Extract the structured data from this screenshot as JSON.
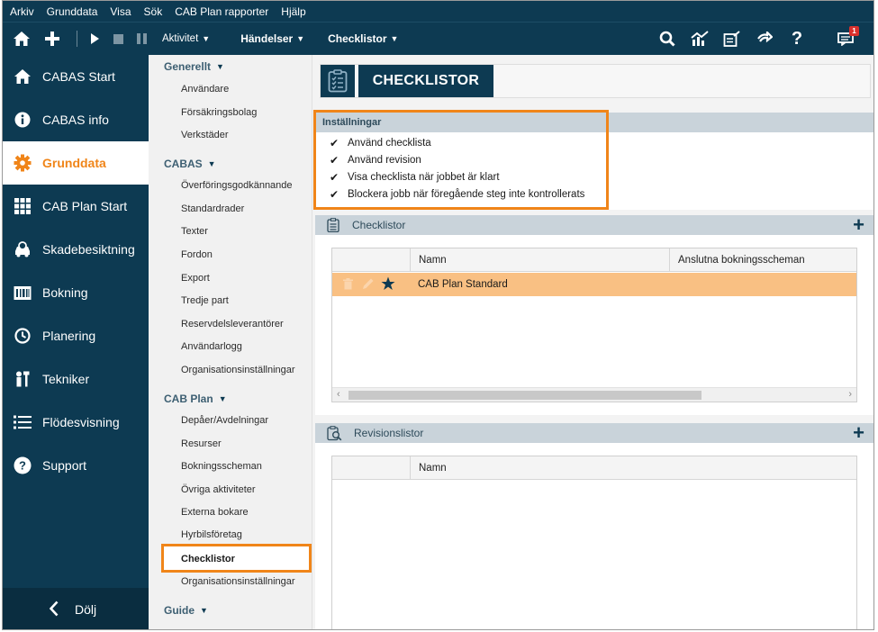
{
  "menubar": [
    "Arkiv",
    "Grunddata",
    "Visa",
    "Sök",
    "CAB Plan rapporter",
    "Hjälp"
  ],
  "toolbar": {
    "activity_label": "Aktivitet",
    "events_label": "Händelser",
    "checklists_label": "Checklistor",
    "notification_count": "1",
    "icons": [
      "home-icon",
      "add-icon",
      "play-icon",
      "stop-icon",
      "pause-icon",
      "search-icon",
      "chart-icon",
      "report-icon",
      "redo-icon",
      "help-icon",
      "notification-icon"
    ]
  },
  "leftnav": {
    "items": [
      {
        "label": "CABAS Start",
        "icon": "home-icon"
      },
      {
        "label": "CABAS info",
        "icon": "info-icon"
      },
      {
        "label": "Grunddata",
        "icon": "gear-icon",
        "active": true
      },
      {
        "label": "CAB Plan Start",
        "icon": "grid-icon"
      },
      {
        "label": "Skadebesiktning",
        "icon": "car-inspection-icon"
      },
      {
        "label": "Bokning",
        "icon": "calendar-icon"
      },
      {
        "label": "Planering",
        "icon": "clock-icon"
      },
      {
        "label": "Tekniker",
        "icon": "technician-icon"
      },
      {
        "label": "Flödesvisning",
        "icon": "list-icon"
      },
      {
        "label": "Support",
        "icon": "question-icon"
      }
    ],
    "hide_label": "Dölj"
  },
  "subnav": {
    "groups": [
      {
        "title": "Generellt",
        "items": [
          "Användare",
          "Försäkringsbolag",
          "Verkstäder"
        ]
      },
      {
        "title": "CABAS",
        "items": [
          "Överföringsgodkännande",
          "Standardrader",
          "Texter",
          "Fordon",
          "Export",
          "Tredje part",
          "Reservdelsleverantörer",
          "Användarlogg",
          "Organisationsinställningar"
        ]
      },
      {
        "title": "CAB Plan",
        "items": [
          "Depåer/Avdelningar",
          "Resurser",
          "Bokningsscheman",
          "Övriga aktiviteter",
          "Externa bokare",
          "Hyrbilsföretag",
          "Checklistor",
          "Organisationsinställningar"
        ]
      },
      {
        "title": "Guide",
        "items": []
      }
    ],
    "selected": "Checklistor"
  },
  "main": {
    "title": "CHECKLISTOR",
    "settings": {
      "title": "Inställningar",
      "options": [
        {
          "label": "Använd checklista",
          "checked": true
        },
        {
          "label": "Använd revision",
          "checked": true
        },
        {
          "label": "Visa checklista när jobbet är klart",
          "checked": true
        },
        {
          "label": "Blockera jobb när föregående steg inte kontrollerats",
          "checked": true
        }
      ]
    },
    "checklists": {
      "title": "Checklistor",
      "columns": [
        "Namn",
        "Anslutna bokningsscheman"
      ],
      "rows": [
        {
          "name": "CAB Plan Standard",
          "schedules": ""
        }
      ]
    },
    "revisions": {
      "title": "Revisionslistor",
      "columns": [
        "Namn"
      ],
      "rows": []
    }
  },
  "colors": {
    "navy": "#0d3a52",
    "accent": "#f08519",
    "row_highlight": "#f9c083",
    "panel_header": "#c9d3da"
  }
}
